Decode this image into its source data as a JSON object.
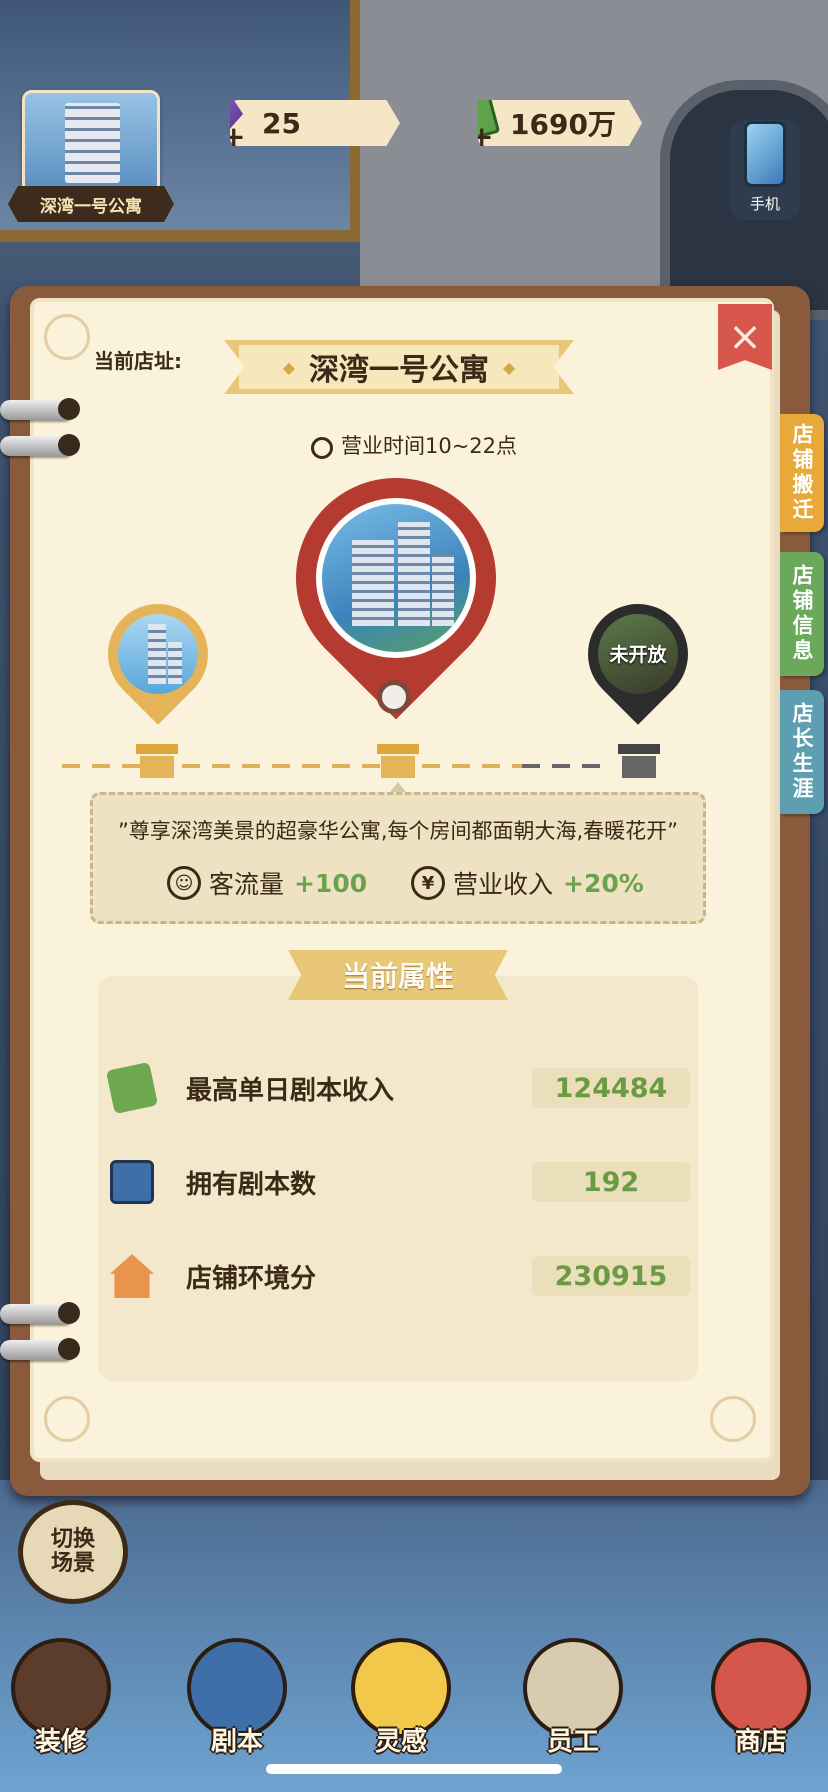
{
  "hud": {
    "scene_name": "深湾一号公寓",
    "gems": "25",
    "cash": "1690万",
    "phone_label": "手机"
  },
  "book": {
    "current_address_label": "当前店址:",
    "store_name": "深湾一号公寓",
    "hours": "营业时间10~22点",
    "locked_label": "未开放",
    "description": "”尊享深湾美景的超豪华公寓,每个房间都面朝大海,春暖花开”",
    "bonuses": [
      {
        "label": "客流量",
        "value": "+100"
      },
      {
        "label": "营业收入",
        "value": "+20%"
      }
    ],
    "attributes_title": "当前属性",
    "attributes": [
      {
        "label": "最高单日剧本收入",
        "value": "124484"
      },
      {
        "label": "拥有剧本数",
        "value": "192"
      },
      {
        "label": "店铺环境分",
        "value": "230915"
      }
    ],
    "close_icon": "×"
  },
  "side_tabs": [
    {
      "label": "店铺搬迁",
      "color": "#e9a83a"
    },
    {
      "label": "店铺信息",
      "color": "#6aa85a"
    },
    {
      "label": "店长生涯",
      "color": "#5d9fb0"
    }
  ],
  "bottom": {
    "switch_scene": "切换场景",
    "nav": [
      "装修",
      "剧本",
      "灵感",
      "员工",
      "商店"
    ]
  },
  "colors": {
    "accent_gold": "#e9c779",
    "pin_red": "#b53a30",
    "value_green": "#6a9a42"
  }
}
